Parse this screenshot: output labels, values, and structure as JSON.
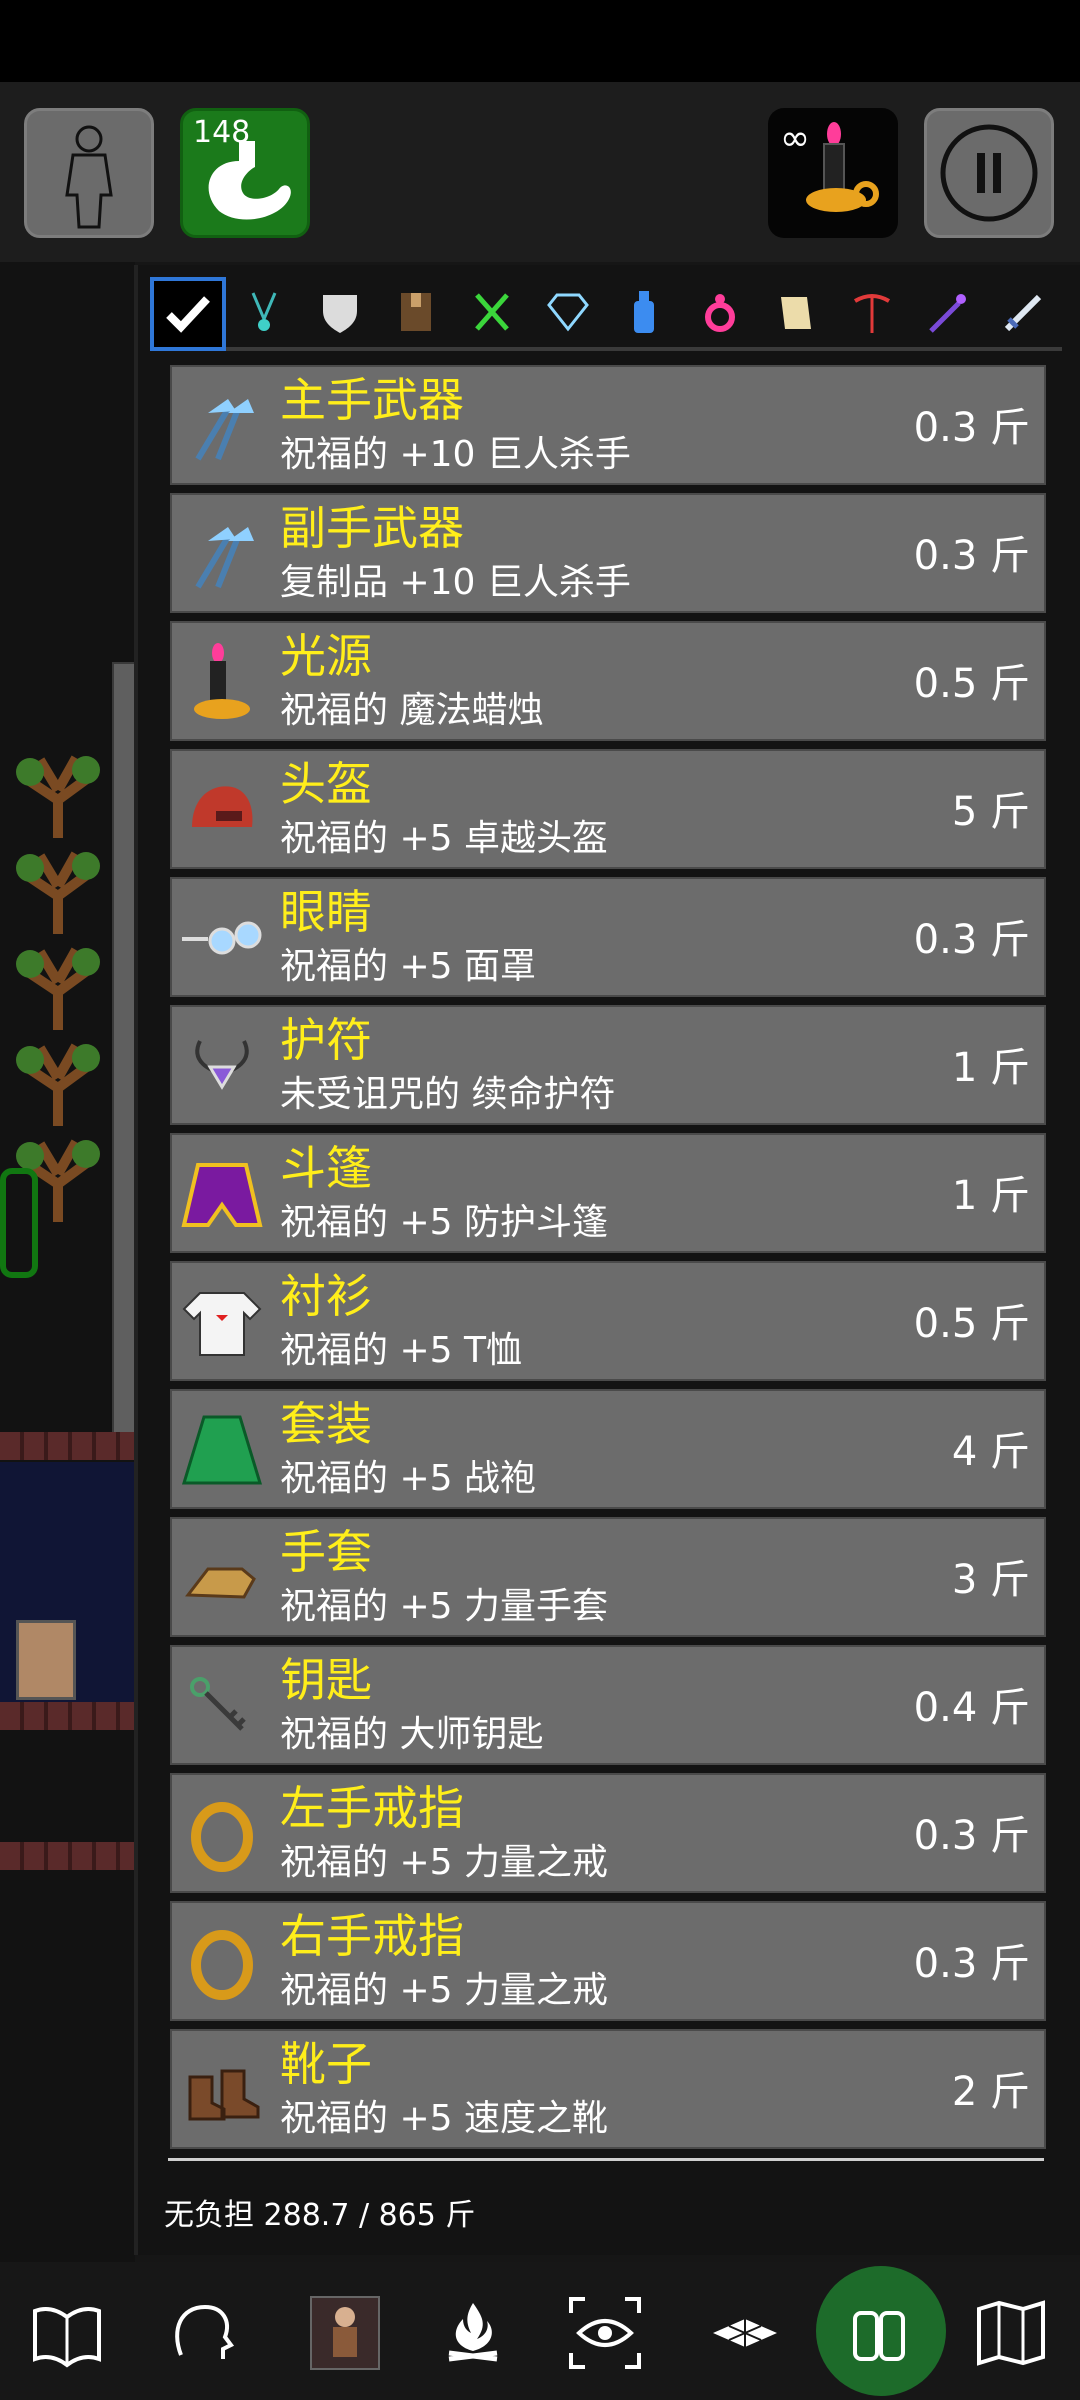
{
  "hud": {
    "hunger_value": "148",
    "light_indicator": "∞"
  },
  "tabs": [
    {
      "icon": "check-icon",
      "selected": true
    },
    {
      "icon": "amulet-icon"
    },
    {
      "icon": "shield-icon"
    },
    {
      "icon": "book-icon"
    },
    {
      "icon": "utensils-icon"
    },
    {
      "icon": "gem-icon"
    },
    {
      "icon": "potion-icon"
    },
    {
      "icon": "ring-icon"
    },
    {
      "icon": "scroll-icon"
    },
    {
      "icon": "pickaxe-icon"
    },
    {
      "icon": "wand-icon"
    },
    {
      "icon": "sword-icon"
    }
  ],
  "inventory": [
    {
      "slot": "主手武器",
      "item": "祝福的 +10 巨人杀手",
      "weight": "0.3 斤",
      "icon": "axe-icon"
    },
    {
      "slot": "副手武器",
      "item": "复制品 +10 巨人杀手",
      "weight": "0.3 斤",
      "icon": "axe-icon"
    },
    {
      "slot": "光源",
      "item": "祝福的 魔法蜡烛",
      "weight": "0.5 斤",
      "icon": "candle-icon"
    },
    {
      "slot": "头盔",
      "item": "祝福的 +5 卓越头盔",
      "weight": "5 斤",
      "icon": "helmet-icon"
    },
    {
      "slot": "眼睛",
      "item": "祝福的 +5 面罩",
      "weight": "0.3 斤",
      "icon": "goggles-icon"
    },
    {
      "slot": "护符",
      "item": "未受诅咒的 续命护符",
      "weight": "1 斤",
      "icon": "amulet-icon"
    },
    {
      "slot": "斗篷",
      "item": "祝福的 +5 防护斗篷",
      "weight": "1 斤",
      "icon": "cloak-icon"
    },
    {
      "slot": "衬衫",
      "item": "祝福的 +5 T恤",
      "weight": "0.5 斤",
      "icon": "shirt-icon"
    },
    {
      "slot": "套装",
      "item": "祝福的 +5 战袍",
      "weight": "4 斤",
      "icon": "robe-icon"
    },
    {
      "slot": "手套",
      "item": "祝福的 +5 力量手套",
      "weight": "3 斤",
      "icon": "gauntlet-icon"
    },
    {
      "slot": "钥匙",
      "item": "祝福的 大师钥匙",
      "weight": "0.4 斤",
      "icon": "key-icon"
    },
    {
      "slot": "左手戒指",
      "item": "祝福的 +5 力量之戒",
      "weight": "0.3 斤",
      "icon": "ring-icon"
    },
    {
      "slot": "右手戒指",
      "item": "祝福的 +5 力量之戒",
      "weight": "0.3 斤",
      "icon": "ring-icon"
    },
    {
      "slot": "靴子",
      "item": "祝福的 +5 速度之靴",
      "weight": "2 斤",
      "icon": "boots-icon"
    }
  ],
  "footer": {
    "burden": "无负担 288.7 / 865 斤"
  },
  "bottom_bar": [
    {
      "icon": "book-icon"
    },
    {
      "icon": "head-icon"
    },
    {
      "icon": "character-icon"
    },
    {
      "icon": "campfire-icon"
    },
    {
      "icon": "eye-target-icon"
    },
    {
      "icon": "tiles-icon"
    },
    {
      "icon": "gloves-icon"
    },
    {
      "icon": "map-icon"
    }
  ],
  "colors": {
    "slot_label": "#ffee1a",
    "row_bg": "#6c6c6c",
    "tab_selected": "#2f77d8"
  }
}
